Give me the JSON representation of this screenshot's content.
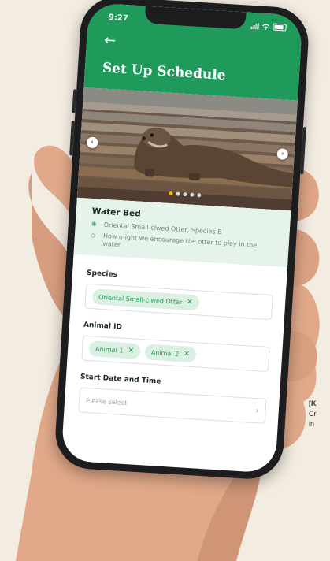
{
  "status_bar": {
    "time": "9:27"
  },
  "header": {
    "title": "Set Up Schedule",
    "back_icon": "arrow-left-icon"
  },
  "gallery": {
    "slide_count": 5,
    "active_slide": 1,
    "accent": "#f5b400"
  },
  "info": {
    "title": "Water Bed",
    "species_line": "Oriental Small-clwed Otter, Species B",
    "question_line": "How might we encourage the otter to play in the water"
  },
  "form": {
    "species": {
      "label": "Species",
      "chips": [
        "Oriental Small-clwed Otter"
      ]
    },
    "animal_id": {
      "label": "Animal ID",
      "chips": [
        "Animal 1",
        "Animal 2"
      ]
    },
    "start": {
      "label": "Start Date and Time",
      "placeholder": "Please select"
    }
  },
  "colors": {
    "brand_green": "#1f9a5a",
    "info_bg": "#e6f3ea",
    "chip_bg": "#dbf0e2"
  }
}
